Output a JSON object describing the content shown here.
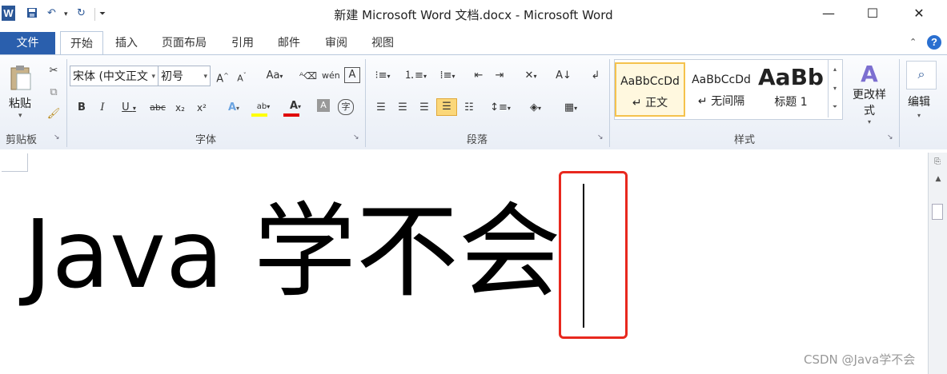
{
  "window": {
    "title": "新建 Microsoft Word 文档.docx - Microsoft Word",
    "app_icon": "W",
    "controls": {
      "minimize": "—",
      "maximize": "☐",
      "close": "✕"
    }
  },
  "ribbon_tabs": [
    "文件",
    "开始",
    "插入",
    "页面布局",
    "引用",
    "邮件",
    "审阅",
    "视图"
  ],
  "active_tab": "开始",
  "clipboard": {
    "paste_label": "粘贴",
    "group_label": "剪贴板"
  },
  "font": {
    "family": "宋体 (中文正文",
    "size": "初号",
    "group_label": "字体",
    "text_color": "#e00000",
    "highlight_color": "#ffff00"
  },
  "paragraph": {
    "group_label": "段落"
  },
  "styles": {
    "items": [
      {
        "preview": "AaBbCcDd",
        "name": "↵ 正文"
      },
      {
        "preview": "AaBbCcDd",
        "name": "↵ 无间隔"
      },
      {
        "preview": "AaBb",
        "name": "标题 1"
      }
    ],
    "change_label": "更改样式",
    "group_label": "样式"
  },
  "editing": {
    "label": "编辑"
  },
  "document": {
    "text_latin": "Java ",
    "text_cjk": "学不会"
  },
  "watermark": "CSDN @Java学不会",
  "accent_color": "#2a5fad",
  "annotation_color": "#e8281e"
}
